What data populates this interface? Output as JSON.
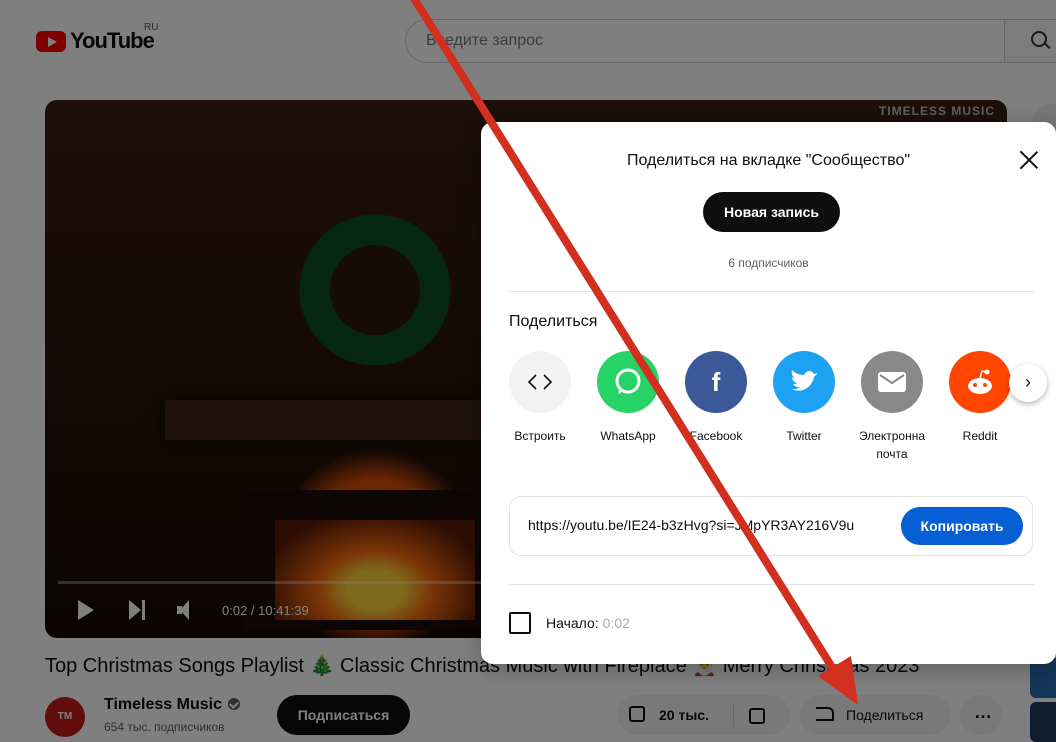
{
  "header": {
    "logo_text": "YouTube",
    "logo_region": "RU",
    "search_placeholder": "Введите запрос"
  },
  "player": {
    "watermark": "TIMELESS MUSIC",
    "time": "0:02 / 10:41:39",
    "progress_fraction": 0.0
  },
  "video": {
    "title": "Top Christmas Songs Playlist 🎄 Classic Christmas Music with Fireplace 🎅 Merry Christmas 2023",
    "channel_avatar_text": "TM",
    "channel_name": "Timeless Music",
    "channel_subs": "654 тыс. подписчиков",
    "subscribe_label": "Подписаться",
    "likes": "20 тыс.",
    "share_label": "Поделиться",
    "more_label": "…"
  },
  "share_dialog": {
    "community_heading": "Поделиться на вкладке \"Сообщество\"",
    "new_post_label": "Новая запись",
    "subscriber_count": "6 подписчиков",
    "share_heading": "Поделиться",
    "targets": [
      {
        "label": "Встроить",
        "icon": "embed-icon",
        "color": "#f2f2f2"
      },
      {
        "label": "WhatsApp",
        "icon": "whatsapp-icon",
        "color": "#25d366"
      },
      {
        "label": "Facebook",
        "icon": "facebook-icon",
        "color": "#3b5998"
      },
      {
        "label": "Twitter",
        "icon": "twitter-icon",
        "color": "#1da1f2"
      },
      {
        "label": "Электронна почта",
        "icon": "email-icon",
        "color": "#888888"
      },
      {
        "label": "Reddit",
        "icon": "reddit-icon",
        "color": "#ff4500"
      }
    ],
    "link": "https://youtu.be/IE24-b3zHvg?si=JMpYR3AY216V9u",
    "copy_label": "Копировать",
    "start_label": "Начало:",
    "start_time": "0:02"
  },
  "colors": {
    "accent_blue": "#065fd4",
    "youtube_red": "#ff0000",
    "annotation_arrow": "#d32f1e"
  }
}
